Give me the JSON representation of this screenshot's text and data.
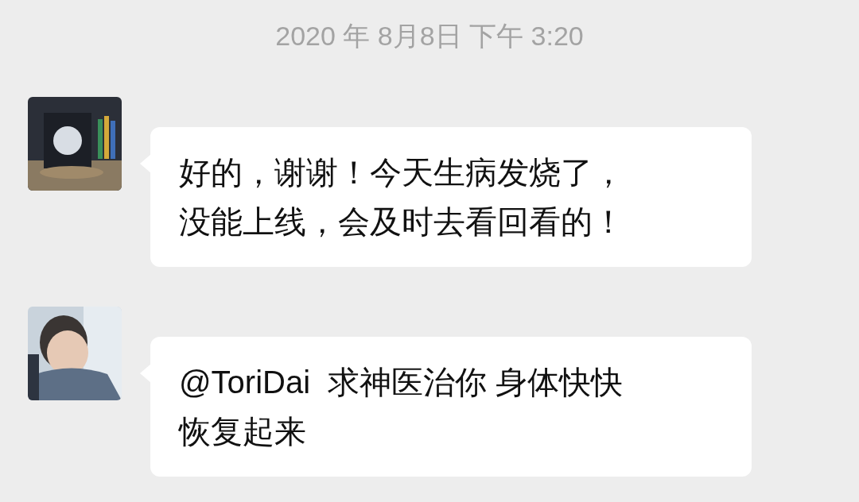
{
  "timestamp": "2020 年 8月8日 下午 3:20",
  "messages": [
    {
      "lines": [
        "好的，谢谢！今天生病发烧了，",
        "没能上线，会及时去看回看的！"
      ]
    },
    {
      "lines": [
        "@ToriDai  求神医治你 身体快快",
        "恢复起来"
      ]
    }
  ]
}
